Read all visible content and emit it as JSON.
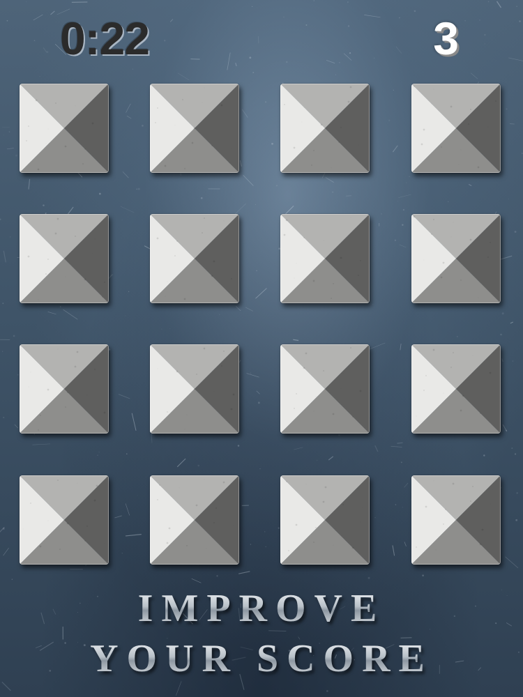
{
  "hud": {
    "timer": "0:22",
    "score": "3"
  },
  "board": {
    "rows": 4,
    "columns": 4,
    "tile_count": 16,
    "tile_icon": "pyramid-stud-icon",
    "colors": {
      "face_light": "#e9e9e7",
      "face_top": "#b3b3b1",
      "face_bottom": "#8e8e8c",
      "face_dark": "#5f5f5e",
      "background": "#3f5468"
    }
  },
  "banner": {
    "line1": "IMPROVE",
    "line2": "YOUR SCORE"
  }
}
